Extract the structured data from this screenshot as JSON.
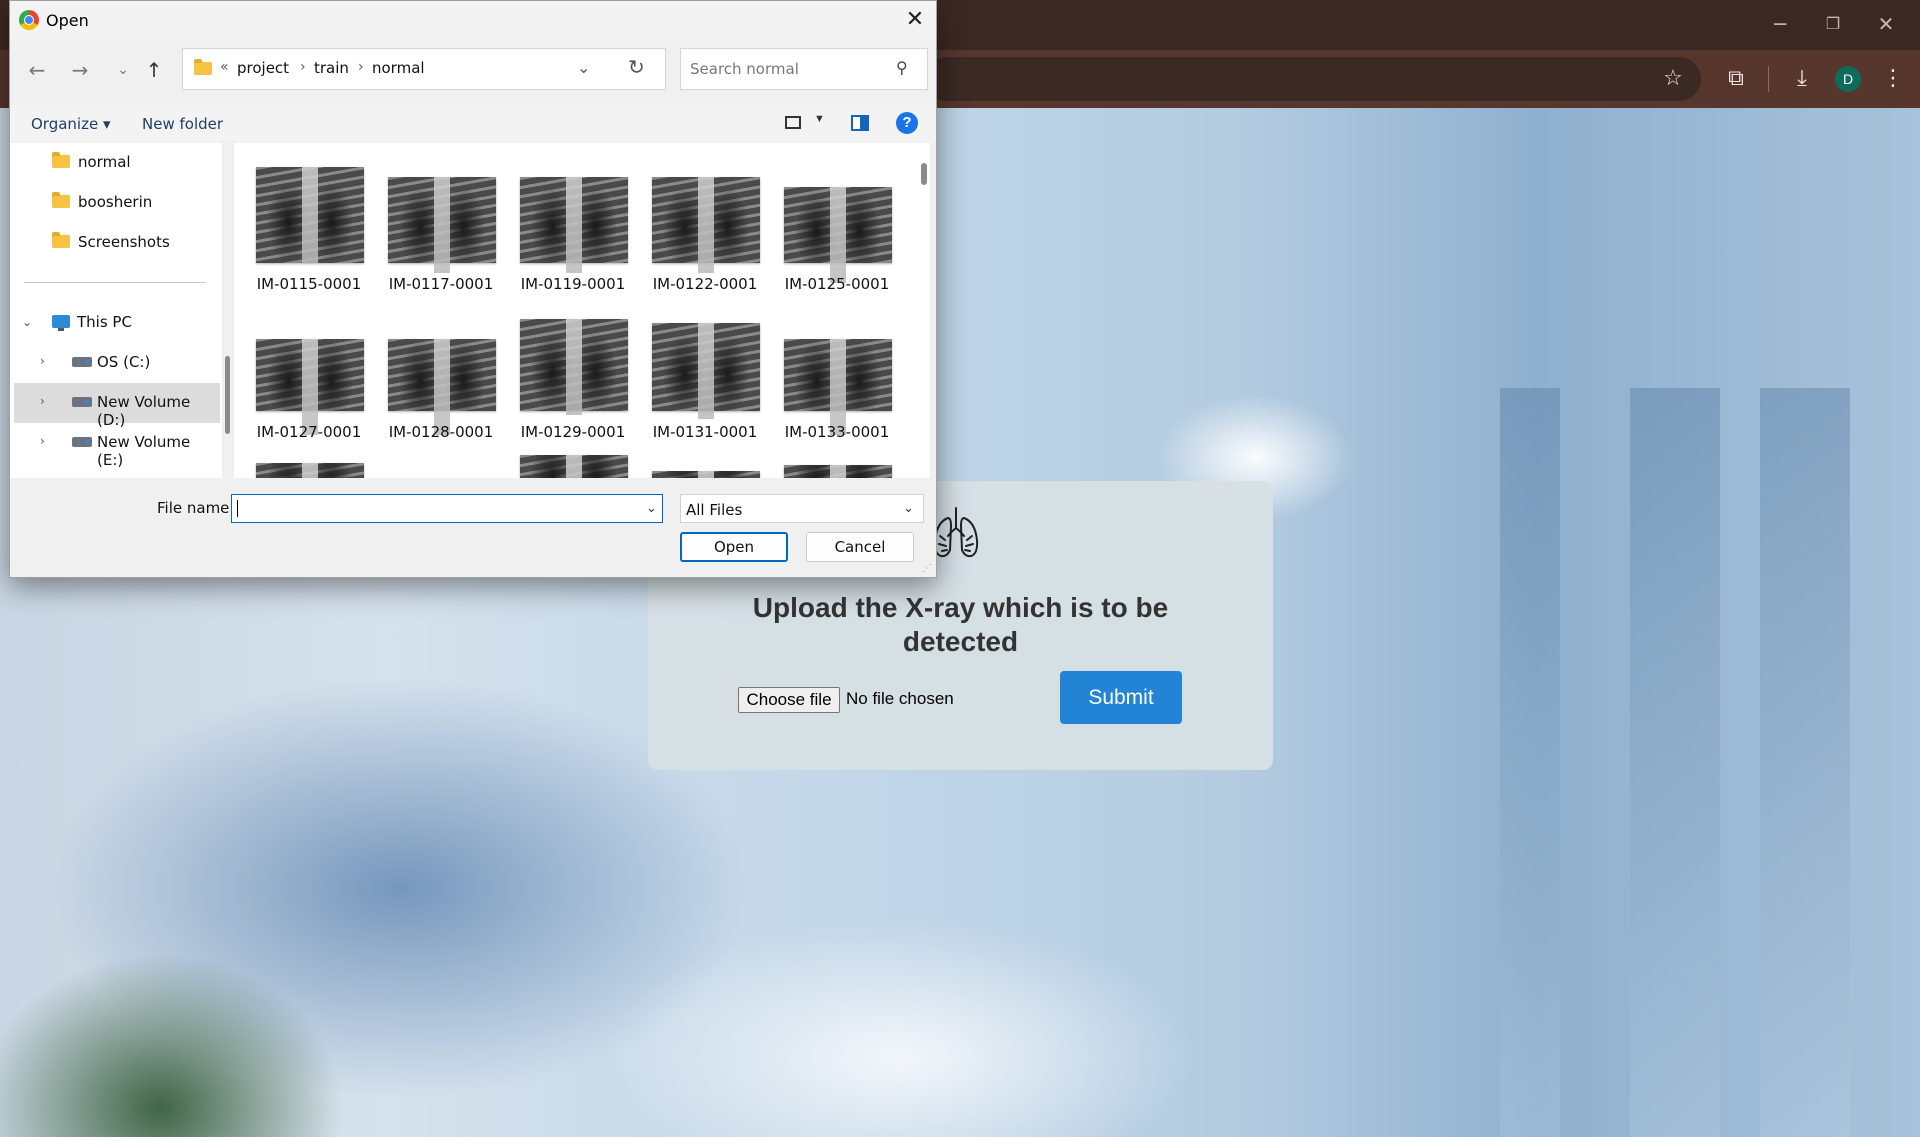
{
  "browser": {
    "profile_initial": "D",
    "icons": [
      "minimize-icon",
      "restore-icon",
      "close-icon",
      "bookmark-star-icon",
      "extensions-icon",
      "download-icon",
      "menu-kebab-icon"
    ]
  },
  "upload_card": {
    "icon": "lungs-icon",
    "title": "Upload the X-ray which is to be detected",
    "choose_file_label": "Choose file",
    "no_file_text": "No file chosen",
    "submit_label": "Submit",
    "submit_color": "#2383d5"
  },
  "dialog": {
    "title": "Open",
    "breadcrumb": {
      "overflow": "«",
      "parts": [
        "project",
        "train",
        "normal"
      ]
    },
    "search_placeholder": "Search normal",
    "commands": {
      "organize": "Organize",
      "new_folder": "New folder"
    },
    "nav": {
      "folders": [
        "normal",
        "boosherin",
        "Screenshots"
      ],
      "this_pc": "This PC",
      "drives": [
        "OS (C:)",
        "New Volume (D:)",
        "New Volume (E:)"
      ],
      "selected": "New Volume (D:)"
    },
    "files": [
      "IM-0115-0001",
      "IM-0117-0001",
      "IM-0119-0001",
      "IM-0122-0001",
      "IM-0125-0001",
      "IM-0127-0001",
      "IM-0128-0001",
      "IM-0129-0001",
      "IM-0131-0001",
      "IM-0133-0001"
    ],
    "file_name_label": "File name:",
    "file_name_value": "",
    "file_type": "All Files",
    "open_label": "Open",
    "cancel_label": "Cancel",
    "accent_color": "#0067c0"
  }
}
